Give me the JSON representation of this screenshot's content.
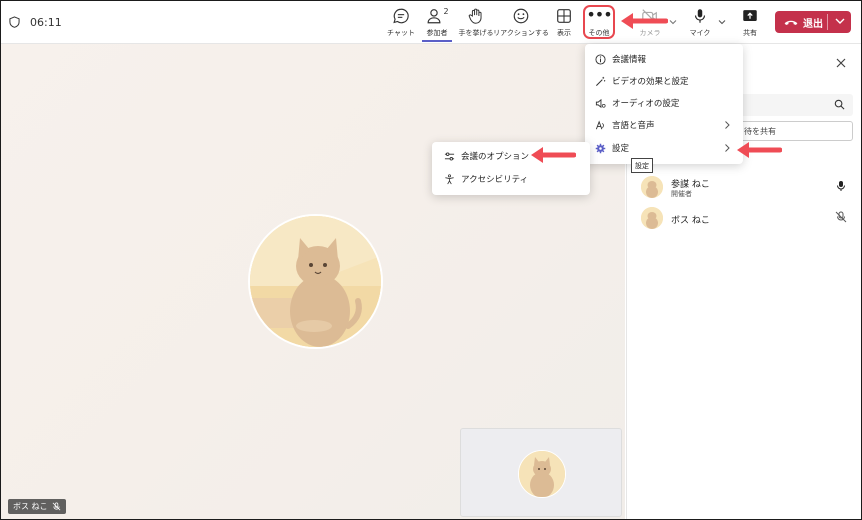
{
  "topbar": {
    "timer": "06:11",
    "buttons": {
      "chat": "チャット",
      "people": "参加者",
      "people_count": "2",
      "raise_hand": "手を挙げる",
      "react": "リアクションする",
      "view": "表示",
      "more": "その他",
      "camera": "カメラ",
      "mic": "マイク",
      "share": "共有"
    },
    "leave": "退出"
  },
  "more_menu": {
    "items": [
      "会議情報",
      "ビデオの効果と設定",
      "オーディオの設定",
      "言語と音声",
      "設定"
    ]
  },
  "settings_submenu": {
    "items": [
      "会議のオプション",
      "アクセシビリティ"
    ]
  },
  "tooltip": "設定",
  "panel": {
    "share_link": "待を共有",
    "participants": [
      {
        "name": "参謀 ねこ",
        "role": "開催者"
      },
      {
        "name": "ボス ねこ",
        "role": ""
      }
    ]
  },
  "stage": {
    "self_name": "ボス ねこ"
  },
  "colors": {
    "accent": "#5b5fc7",
    "leave": "#c4314b",
    "highlight": "#e8474f"
  }
}
